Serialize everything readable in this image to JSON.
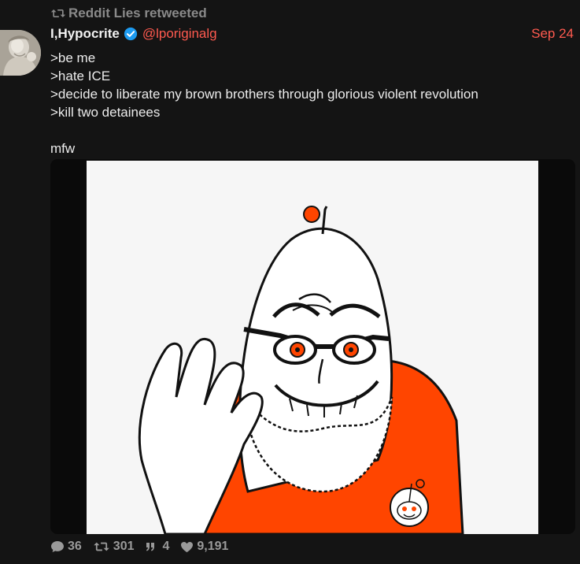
{
  "retweet": {
    "icon": "retweet-icon",
    "label": "Reddit Lies retweeted"
  },
  "author": {
    "name": "I,Hypocrite",
    "handle": "@lporiginalg",
    "verified_icon": "verified-badge-icon",
    "date": "Sep 24"
  },
  "tweet": {
    "lines": [
      ">be me",
      ">hate ICE",
      ">decide to liberate my brown brothers through glorious violent revolution",
      ">kill two detainees",
      "",
      "mfw"
    ]
  },
  "media": {
    "description_icon": "reddit-snoo-meme-image"
  },
  "actions": {
    "replies": "36",
    "retweets": "301",
    "quotes": "4",
    "likes": "9,191"
  },
  "colors": {
    "background": "#141414",
    "accent": "#ff5a4f",
    "muted": "#8a8a8a",
    "verified": "#1d9bf0"
  }
}
